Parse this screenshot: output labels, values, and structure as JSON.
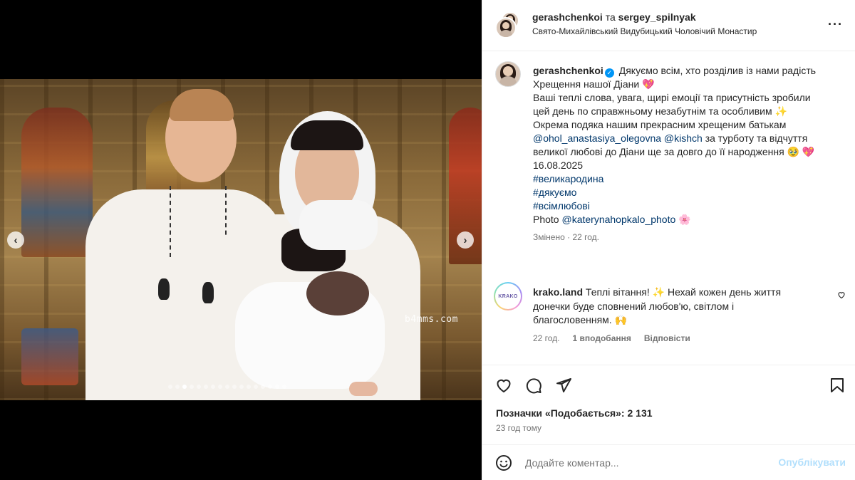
{
  "post": {
    "header": {
      "user1": "gerashchenkoi",
      "conjunction": "та",
      "user2": "sergey_spilnyak",
      "location": "Свято-Михайлівський Видубицький Чоловічий Монастир"
    },
    "caption": {
      "username": "gerashchenkoi",
      "l1": "Дякуємо всім, хто розділив із нами радість",
      "l2": "Хрещення нашої Діани",
      "l3": "Ваші теплі слова, увага, щирі емоції та присутність зробили",
      "l4": "цей день по справжньому незабутнім та особливим",
      "l5": "Окрема подяка нашим прекрасним хрещеним батькам",
      "mention1": "@ohol_anastasiya_olegovna",
      "mention2": "@kishch",
      "l6_tail": "за турботу та відчуття",
      "l7": "великої любові до Діани ще за довго до її народження",
      "date": "16.08.2025",
      "hashtags": [
        "#великародина",
        "#дякуємо",
        "#всімлюбові"
      ],
      "photo_label": "Photo",
      "photo_credit": "@katerynahopkalo_photo",
      "edited": "Змінено",
      "edited_time": "22 год."
    },
    "comment": {
      "avatar_text": "KRAKO",
      "username": "krako.land",
      "t1": "Теплі вітання!",
      "t2": "Нехай кожен день життя",
      "t3": "донечки буде сповнений любов'ю, світлом і",
      "t4": "благословенням.",
      "time": "22 год.",
      "likes": "1 вподобання",
      "reply": "Відповісти"
    },
    "likes_text": "Позначки «Подобається»: 2 131",
    "posted_ago": "23 год тому",
    "add_comment_placeholder": "Додайте коментар...",
    "publish_label": "Опублікувати",
    "media": {
      "watermark": "b4mms.com",
      "slide_count": 17,
      "active_slide": 2
    }
  }
}
